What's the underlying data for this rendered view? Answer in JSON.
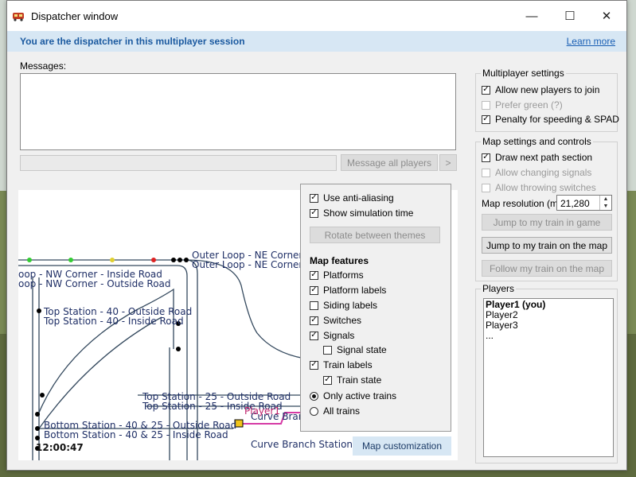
{
  "window": {
    "title": "Dispatcher window",
    "minimize": "—",
    "maximize": "☐",
    "close": "✕"
  },
  "info": {
    "text": "You are the dispatcher in this multiplayer session",
    "learn_more": "Learn more"
  },
  "messages": {
    "label": "Messages:",
    "input_value": "",
    "send_all": "Message all players",
    "send_next": ">"
  },
  "map": {
    "clock": "12:00:47",
    "labels": {
      "outer_ne_1": "Outer Loop - NE Corner",
      "outer_ne_2": "Outer Loop - NE Corner",
      "nw_inside": "oop - NW Corner - Inside Road",
      "nw_outside": "oop - NW Corner - Outside Road",
      "top40_out": "Top Station - 40 - Outside Road",
      "top40_in": "Top Station - 40 - Inside Road",
      "top25_out": "Top Station - 25 - Outside Road",
      "top25_in": "Top Station - 25 - Inside Road",
      "bot_out": "Bottom Station - 40 & 25 - Outside Road",
      "bot_in": "Bottom Station - 40 & 25 - Inside Road",
      "curve1": "Curve Branch",
      "curve2": "Curve Branch Station - I",
      "player": "Player1"
    },
    "signal_colors": {
      "green": "#33cc33",
      "yellow": "#e0d030",
      "red": "#dd2222"
    },
    "customization_button": "Map customization"
  },
  "overlay": {
    "anti_aliasing": "Use anti-aliasing",
    "show_sim_time": "Show simulation time",
    "rotate_themes": "Rotate between themes",
    "features_title": "Map features",
    "platforms": "Platforms",
    "platform_labels": "Platform labels",
    "siding_labels": "Siding labels",
    "switches": "Switches",
    "signals": "Signals",
    "signal_state": "Signal state",
    "train_labels": "Train labels",
    "train_state": "Train state",
    "only_active": "Only active trains",
    "all_trains": "All trains"
  },
  "multiplayer": {
    "title": "Multiplayer settings",
    "allow_join": "Allow new players to join",
    "prefer_green": "Prefer green (?)",
    "penalty": "Penalty for speeding & SPAD"
  },
  "mapsettings": {
    "title": "Map settings and controls",
    "draw_path": "Draw next path section",
    "allow_signals": "Allow changing signals",
    "allow_switches": "Allow throwing switches",
    "resolution_label": "Map resolution (m):",
    "resolution_value": "21,280",
    "jump_game": "Jump to my train in game",
    "jump_map": "Jump to my train on the map",
    "follow_map": "Follow my train on the map"
  },
  "players": {
    "title": "Players",
    "list": [
      "Player1 (you)",
      "Player2",
      "Player3",
      "..."
    ]
  }
}
